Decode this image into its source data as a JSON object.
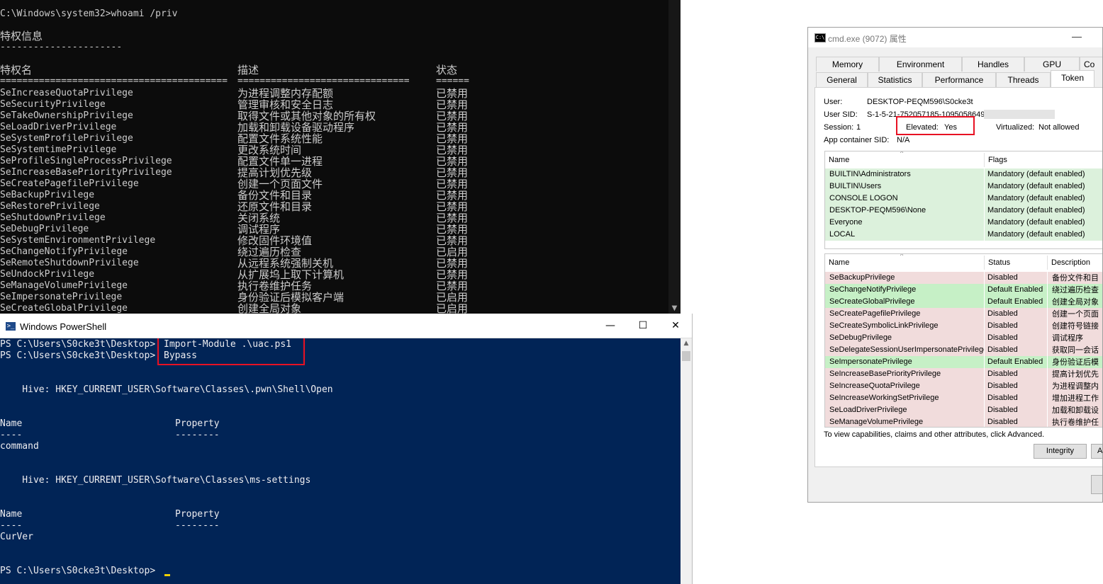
{
  "cmd": {
    "command_line": "C:\\Windows\\system32>whoami /priv",
    "heading": "特权信息",
    "heading_rule": "----------------------",
    "col_name": "特权名",
    "col_desc": "描述",
    "col_state": "状态",
    "sep_name": "=========================================",
    "sep_desc": "===============================",
    "sep_state": "======",
    "rows": [
      {
        "name": "SeIncreaseQuotaPrivilege",
        "desc": "为进程调整内存配额",
        "state": "已禁用"
      },
      {
        "name": "SeSecurityPrivilege",
        "desc": "管理审核和安全日志",
        "state": "已禁用"
      },
      {
        "name": "SeTakeOwnershipPrivilege",
        "desc": "取得文件或其他对象的所有权",
        "state": "已禁用"
      },
      {
        "name": "SeLoadDriverPrivilege",
        "desc": "加载和卸载设备驱动程序",
        "state": "已禁用"
      },
      {
        "name": "SeSystemProfilePrivilege",
        "desc": "配置文件系统性能",
        "state": "已禁用"
      },
      {
        "name": "SeSystemtimePrivilege",
        "desc": "更改系统时间",
        "state": "已禁用"
      },
      {
        "name": "SeProfileSingleProcessPrivilege",
        "desc": "配置文件单一进程",
        "state": "已禁用"
      },
      {
        "name": "SeIncreaseBasePriorityPrivilege",
        "desc": "提高计划优先级",
        "state": "已禁用"
      },
      {
        "name": "SeCreatePagefilePrivilege",
        "desc": "创建一个页面文件",
        "state": "已禁用"
      },
      {
        "name": "SeBackupPrivilege",
        "desc": "备份文件和目录",
        "state": "已禁用"
      },
      {
        "name": "SeRestorePrivilege",
        "desc": "还原文件和目录",
        "state": "已禁用"
      },
      {
        "name": "SeShutdownPrivilege",
        "desc": "关闭系统",
        "state": "已禁用"
      },
      {
        "name": "SeDebugPrivilege",
        "desc": "调试程序",
        "state": "已禁用"
      },
      {
        "name": "SeSystemEnvironmentPrivilege",
        "desc": "修改固件环境值",
        "state": "已禁用"
      },
      {
        "name": "SeChangeNotifyPrivilege",
        "desc": "绕过遍历检查",
        "state": "已启用"
      },
      {
        "name": "SeRemoteShutdownPrivilege",
        "desc": "从远程系统强制关机",
        "state": "已禁用"
      },
      {
        "name": "SeUndockPrivilege",
        "desc": "从扩展坞上取下计算机",
        "state": "已禁用"
      },
      {
        "name": "SeManageVolumePrivilege",
        "desc": "执行卷维护任务",
        "state": "已禁用"
      },
      {
        "name": "SeImpersonatePrivilege",
        "desc": "身份验证后模拟客户端",
        "state": "已启用"
      },
      {
        "name": "SeCreateGlobalPrivilege",
        "desc": "创建全局对象",
        "state": "已启用"
      }
    ]
  },
  "powershell": {
    "title": "Windows PowerShell",
    "prompt": "PS C:\\Users\\S0cke3t\\Desktop>",
    "cmd1": "Import-Module .\\uac.ps1",
    "cmd2": "Bypass",
    "hive1": "    Hive: HKEY_CURRENT_USER\\Software\\Classes\\.pwn\\Shell\\Open",
    "hive2": "    Hive: HKEY_CURRENT_USER\\Software\\Classes\\ms-settings",
    "col_name": "Name",
    "col_property": "Property",
    "dash_name": "----",
    "dash_property": "--------",
    "item1": "command",
    "item2": "CurVer",
    "final_prompt": "PS C:\\Users\\S0cke3t\\Desktop>",
    "btn_min": "—",
    "btn_max": "☐",
    "btn_close": "✕"
  },
  "properties": {
    "title": "cmd.exe (9072) 属性",
    "tabs_row1": [
      "Memory",
      "Environment",
      "Handles",
      "GPU",
      "Co"
    ],
    "tabs_row2": [
      "General",
      "Statistics",
      "Performance",
      "Threads",
      "Token"
    ],
    "active_tab": "Token",
    "user_label": "User:",
    "user_value": "DESKTOP-PEQM596\\S0cke3t",
    "sid_label": "User SID:",
    "sid_value": "S-1-5-21-752057185-1095058649",
    "session_label": "Session:",
    "session_value": "1",
    "elevated_label": "Elevated:",
    "elevated_value": "Yes",
    "virtualized_label": "Virtualized:",
    "virtualized_value": "Not allowed",
    "appcontainer_label": "App container SID:",
    "appcontainer_value": "N/A",
    "groups_headers": [
      "Name",
      "Flags"
    ],
    "groups": [
      {
        "name": "BUILTIN\\Administrators",
        "flags": "Mandatory (default enabled)"
      },
      {
        "name": "BUILTIN\\Users",
        "flags": "Mandatory (default enabled)"
      },
      {
        "name": "CONSOLE LOGON",
        "flags": "Mandatory (default enabled)"
      },
      {
        "name": "DESKTOP-PEQM596\\None",
        "flags": "Mandatory (default enabled)"
      },
      {
        "name": "Everyone",
        "flags": "Mandatory (default enabled)"
      },
      {
        "name": "LOCAL",
        "flags": "Mandatory (default enabled)"
      }
    ],
    "privs_headers": [
      "Name",
      "Status",
      "Description"
    ],
    "privileges": [
      {
        "name": "SeBackupPrivilege",
        "status": "Disabled",
        "desc": "备份文件和目"
      },
      {
        "name": "SeChangeNotifyPrivilege",
        "status": "Default Enabled",
        "desc": "绕过遍历检查"
      },
      {
        "name": "SeCreateGlobalPrivilege",
        "status": "Default Enabled",
        "desc": "创建全局对象"
      },
      {
        "name": "SeCreatePagefilePrivilege",
        "status": "Disabled",
        "desc": "创建一个页面"
      },
      {
        "name": "SeCreateSymbolicLinkPrivilege",
        "status": "Disabled",
        "desc": "创建符号链接"
      },
      {
        "name": "SeDebugPrivilege",
        "status": "Disabled",
        "desc": "调试程序"
      },
      {
        "name": "SeDelegateSessionUserImpersonatePrivilege",
        "status": "Disabled",
        "desc": "获取同一会话"
      },
      {
        "name": "SeImpersonatePrivilege",
        "status": "Default Enabled",
        "desc": "身份验证后模"
      },
      {
        "name": "SeIncreaseBasePriorityPrivilege",
        "status": "Disabled",
        "desc": "提高计划优先"
      },
      {
        "name": "SeIncreaseQuotaPrivilege",
        "status": "Disabled",
        "desc": "为进程调整内"
      },
      {
        "name": "SeIncreaseWorkingSetPrivilege",
        "status": "Disabled",
        "desc": "增加进程工作"
      },
      {
        "name": "SeLoadDriverPrivilege",
        "status": "Disabled",
        "desc": "加载和卸载设"
      },
      {
        "name": "SeManageVolumePrivilege",
        "status": "Disabled",
        "desc": "执行卷维护任"
      }
    ],
    "footer_text": "To view capabilities, claims and other attributes, click Advanced.",
    "integrity_button": "Integrity",
    "advanced_button": "A",
    "min_button": "—"
  },
  "colors": {
    "cmd_bg": "#0c0c0c",
    "ps_bg": "#012456",
    "enabled_row": "#c6f0c6",
    "disabled_row": "#f1dcdc",
    "group_row": "#dcf1dc",
    "highlight_box": "#e81123"
  }
}
